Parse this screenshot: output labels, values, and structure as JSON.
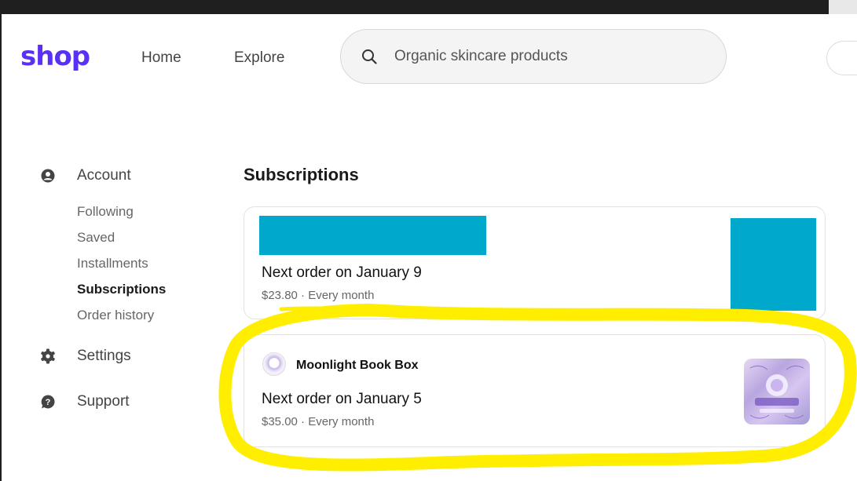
{
  "header": {
    "logo_text": "shop",
    "nav": [
      {
        "label": "Home"
      },
      {
        "label": "Explore"
      }
    ],
    "search": {
      "value": "",
      "placeholder": "Organic skincare products"
    }
  },
  "sidebar": {
    "sections": [
      {
        "label": "Account",
        "icon": "user-circle-icon"
      },
      {
        "label": "Settings",
        "icon": "gear-icon"
      },
      {
        "label": "Support",
        "icon": "help-bubble-icon"
      }
    ],
    "account_items": [
      {
        "label": "Following"
      },
      {
        "label": "Saved"
      },
      {
        "label": "Installments"
      },
      {
        "label": "Subscriptions",
        "active": true
      },
      {
        "label": "Order history"
      }
    ]
  },
  "main": {
    "title": "Subscriptions",
    "subscriptions": [
      {
        "shop_name": "",
        "next_order": "Next order on January 9",
        "price_line": "$23.80 · Every month"
      },
      {
        "shop_name": "Moonlight Book Box",
        "next_order": "Next order on January 5",
        "price_line": "$35.00 · Every month"
      }
    ]
  },
  "colors": {
    "brand": "#5a31f4",
    "placeholder_image": "#00a9cc",
    "highlight": "#ffee00"
  }
}
